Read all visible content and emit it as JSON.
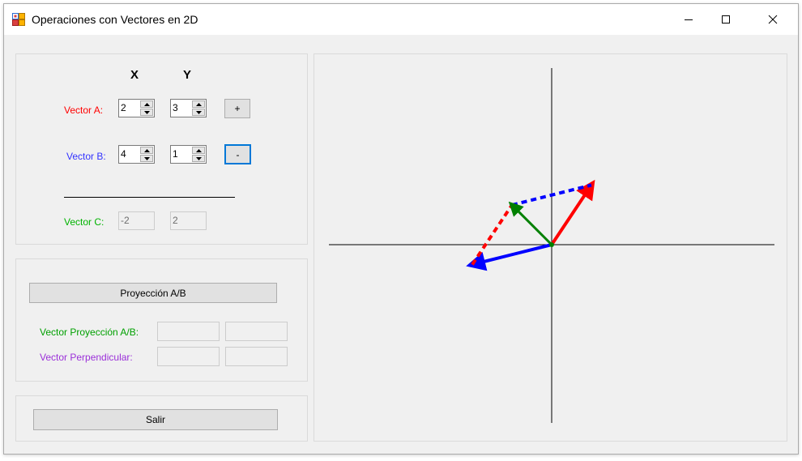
{
  "window": {
    "title": "Operaciones con Vectores en 2D",
    "controls": {
      "minimize": "—",
      "maximize": "☐",
      "close": "✕"
    }
  },
  "vectors_panel": {
    "header_x": "X",
    "header_y": "Y",
    "vector_a": {
      "label": "Vector A:",
      "x": "2",
      "y": "3",
      "color": "#ff0000"
    },
    "vector_b": {
      "label": "Vector B:",
      "x": "4",
      "y": "1",
      "color": "#0000ff"
    },
    "vector_c": {
      "label": "Vector C:",
      "x": "-2",
      "y": "2",
      "color": "#00b300"
    },
    "add_label": "+",
    "subtract_label": "-"
  },
  "projection_panel": {
    "button_label": "Proyección A/B",
    "proj_label": "Vector Proyección A/B:",
    "proj_color": "#00a000",
    "perp_label": "Vector Perpendicular:",
    "perp_color": "#9b30d9",
    "proj_x": "",
    "proj_y": "",
    "perp_x": "",
    "perp_y": ""
  },
  "exit_panel": {
    "button_label": "Salir"
  },
  "plot": {
    "vector_a": [
      2,
      3
    ],
    "vector_b": [
      4,
      1
    ],
    "vector_c": [
      -2,
      2
    ],
    "colors": {
      "a": "#ff0000",
      "b": "#0000ff",
      "c": "#008000",
      "axis": "#000000"
    }
  }
}
